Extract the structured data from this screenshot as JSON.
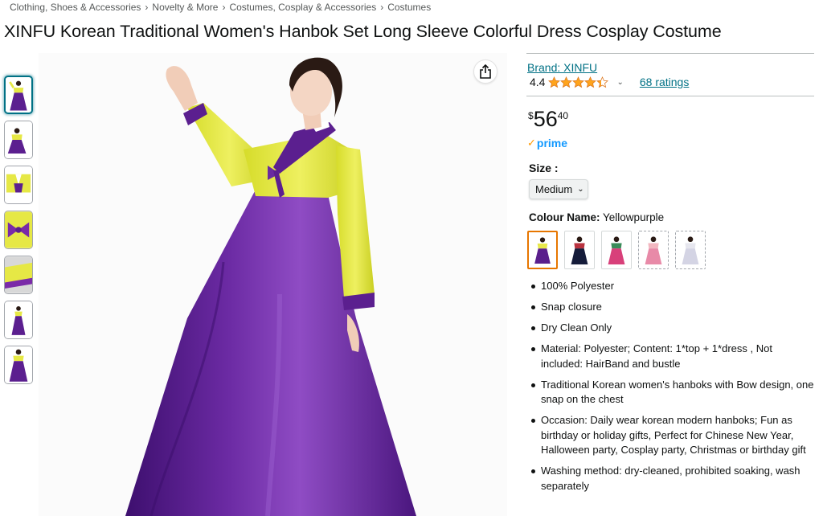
{
  "breadcrumb": [
    "Clothing, Shoes & Accessories",
    "Novelty & More",
    "Costumes, Cosplay & Accessories",
    "Costumes"
  ],
  "breadcrumb_separator": "›",
  "product": {
    "title": "XINFU Korean Traditional Women's Hanbok Set Long Sleeve Colorful Dress Cosplay Costume",
    "brand_text": "Brand: XINFU",
    "rating_value": "4.4",
    "rating_stars": 4.4,
    "ratings_count_text": "68 ratings",
    "price_symbol": "$",
    "price_whole": "56",
    "price_fraction": "40",
    "prime_label": "prime",
    "size_label": "Size :",
    "size_selected": "Medium",
    "colour_label": "Colour Name:",
    "colour_selected": "Yellowpurple",
    "swatches": [
      {
        "top": "#e8e84a",
        "skirt": "#5a1f8c"
      },
      {
        "top": "#b8323f",
        "skirt": "#151c3a"
      },
      {
        "top": "#3a8c5a",
        "skirt": "#d8407a"
      },
      {
        "top": "#f2b7c0",
        "skirt": "#e88aa8"
      },
      {
        "top": "#e6e6ee",
        "skirt": "#d4d4e4"
      }
    ],
    "bullets": [
      "100% Polyester",
      "Snap closure",
      "Dry Clean Only",
      "Material: Polyester; Content: 1*top + 1*dress , Not included: HairBand and bustle",
      "Traditional Korean women's hanboks with Bow design, one snap on the chest",
      "Occasion: Daily wear korean modern hanboks; Fun as birthday or holiday gifts, Perfect for Chinese New Year, Halloween party, Cosplay party, Christmas or birthday gift",
      "Washing method: dry-cleaned, prohibited soaking, wash separately"
    ]
  },
  "colors": {
    "link": "#007185",
    "star": "#ffa41c",
    "prime_blue": "#1399ff",
    "selected_border": "#e77600"
  },
  "icons": {
    "share": "share-icon",
    "star": "star-icon",
    "chevron": "chevron-down-icon",
    "prime_check": "prime-check-icon"
  }
}
